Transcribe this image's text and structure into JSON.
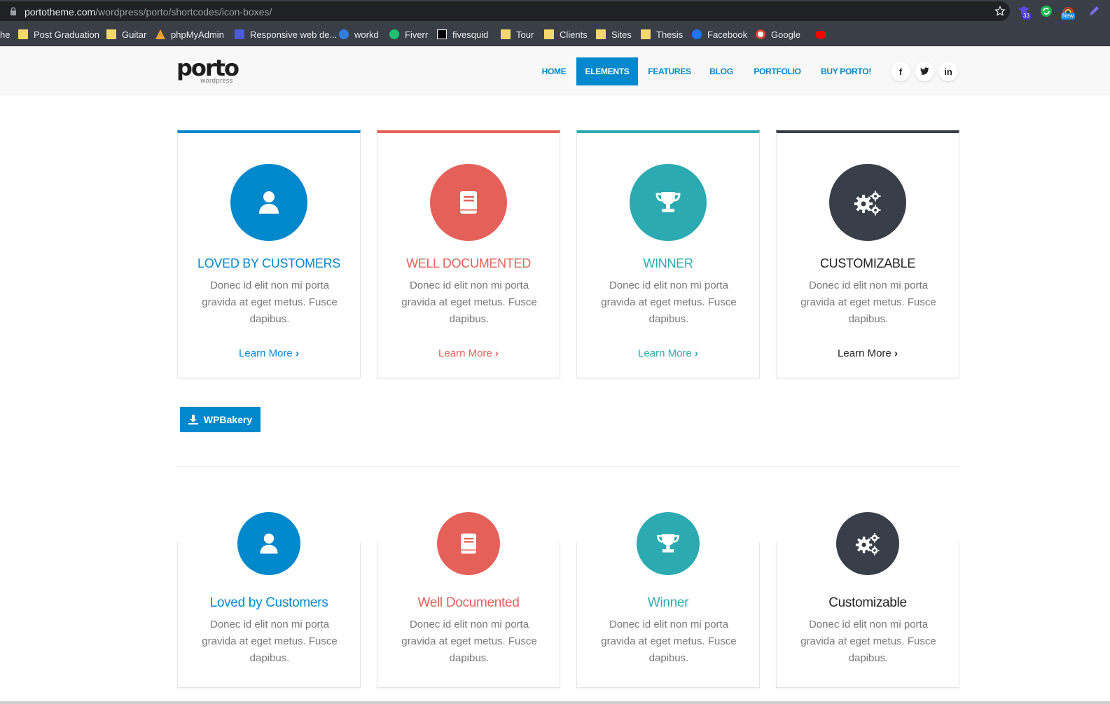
{
  "browser": {
    "url_domain": "portotheme.com",
    "url_path": "/wordpress/porto/shortcodes/icon-boxes/",
    "ext_badge_1": "33",
    "ext_badge_2": "New",
    "bookmarks": [
      {
        "label": "he",
        "icon": "folder-icon"
      },
      {
        "label": "Post Graduation",
        "icon": "folder-icon"
      },
      {
        "label": "Guitar",
        "icon": "folder-icon"
      },
      {
        "label": "phpMyAdmin",
        "icon": "phpmyadmin-icon"
      },
      {
        "label": "Responsive web de...",
        "icon": "w-icon"
      },
      {
        "label": "workd",
        "icon": "workd-icon"
      },
      {
        "label": "Fiverr",
        "icon": "fiverr-icon"
      },
      {
        "label": "fivesquid",
        "icon": "fivesquid-icon"
      },
      {
        "label": "Tour",
        "icon": "folder-icon"
      },
      {
        "label": "Clients",
        "icon": "folder-icon"
      },
      {
        "label": "Sites",
        "icon": "folder-icon"
      },
      {
        "label": "Thesis",
        "icon": "folder-icon"
      },
      {
        "label": "Facebook",
        "icon": "facebook-icon"
      },
      {
        "label": "Google",
        "icon": "google-icon"
      }
    ]
  },
  "site": {
    "logo_text": "porto",
    "logo_sub": "wordpress",
    "nav": [
      "HOME",
      "ELEMENTS",
      "FEATURES",
      "BLOG",
      "PORTFOLIO",
      "BUY PORTO!"
    ],
    "nav_active_index": 1,
    "social": [
      "f",
      "t",
      "in"
    ]
  },
  "colors": {
    "blue": "#0088cc",
    "red": "#e36159",
    "teal": "#2baab1",
    "dark": "#383f48"
  },
  "top_boxes": [
    {
      "title": "LOVED BY CUSTOMERS",
      "text": "Donec id elit non mi porta gravida at eget metus. Fusce dapibus.",
      "link": "Learn More",
      "icon": "user-icon"
    },
    {
      "title": "WELL DOCUMENTED",
      "text": "Donec id elit non mi porta gravida at eget metus. Fusce dapibus.",
      "link": "Learn More",
      "icon": "book-icon"
    },
    {
      "title": "WINNER",
      "text": "Donec id elit non mi porta gravida at eget metus. Fusce dapibus.",
      "link": "Learn More",
      "icon": "trophy-icon"
    },
    {
      "title": "CUSTOMIZABLE",
      "text": "Donec id elit non mi porta gravida at eget metus. Fusce dapibus.",
      "link": "Learn More",
      "icon": "gears-icon"
    }
  ],
  "button": {
    "label": "WPBakery",
    "icon": "download-icon"
  },
  "bottom_boxes": [
    {
      "title": "Loved by Customers",
      "text": "Donec id elit non mi porta gravida at eget metus. Fusce dapibus."
    },
    {
      "title": "Well Documented",
      "text": "Donec id elit non mi porta gravida at eget metus. Fusce dapibus."
    },
    {
      "title": "Winner",
      "text": "Donec id elit non mi porta gravida at eget metus. Fusce dapibus."
    },
    {
      "title": "Customizable",
      "text": "Donec id elit non mi porta gravida at eget metus. Fusce dapibus."
    }
  ]
}
